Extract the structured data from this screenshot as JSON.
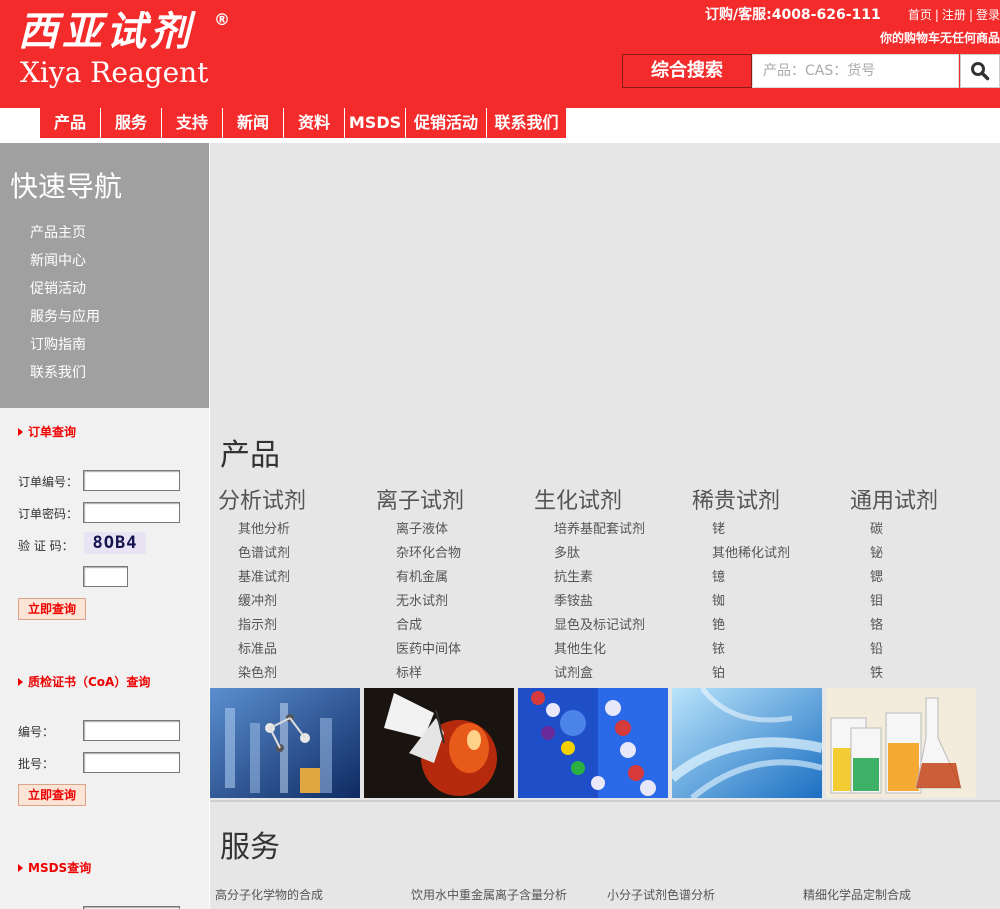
{
  "header": {
    "logo_cn": "西亚试剂",
    "logo_registered": "®",
    "logo_en": "Xiya Reagent",
    "hotline": "订购/客服:4008-626-111",
    "links": [
      "首页",
      "注册",
      "登录"
    ],
    "link_sep": "|",
    "cart_status": "你的购物车无任何商品",
    "search_label": "综合搜索",
    "search_placeholder": "产品：CAS：货号"
  },
  "nav": [
    "产品",
    "服务",
    "支持",
    "新闻",
    "资料",
    "MSDS",
    "促销活动",
    "联系我们"
  ],
  "quicknav": {
    "title": "快速导航",
    "items": [
      "产品主页",
      "新闻中心",
      "促销活动",
      "服务与应用",
      "订购指南",
      "联系我们"
    ]
  },
  "order_query": {
    "title": "订单查询",
    "order_no_label": "订单编号：",
    "order_pwd_label": "订单密码：",
    "captcha_label": "验 证 码：",
    "captcha_text": "8OB4",
    "submit": "立即查询"
  },
  "coa_query": {
    "title": "质检证书（CoA）查询",
    "no_label": "编号：",
    "batch_label": "批号：",
    "submit": "立即查询"
  },
  "msds_query": {
    "title": "MSDS查询"
  },
  "products": {
    "title": "产品",
    "categories": [
      {
        "title": "分析试剂",
        "items": [
          "其他分析",
          "色谱试剂",
          "基准试剂",
          "缓冲剂",
          "指示剂",
          "标准品",
          "染色剂"
        ]
      },
      {
        "title": "离子试剂",
        "items": [
          "离子液体",
          "杂环化合物",
          "有机金属",
          "无水试剂",
          "合成",
          "医药中间体",
          "标样"
        ]
      },
      {
        "title": "生化试剂",
        "items": [
          "培养基配套试剂",
          "多肽",
          "抗生素",
          "季铵盐",
          "显色及标记试剂",
          "其他生化",
          "试剂盒"
        ]
      },
      {
        "title": "稀贵试剂",
        "items": [
          "铑",
          "其他稀化试剂",
          "镱",
          "铷",
          "铯",
          "铱",
          "铂"
        ]
      },
      {
        "title": "通用试剂",
        "items": [
          "碳",
          "铋",
          "锶",
          "钼",
          "铬",
          "铅",
          "铁"
        ]
      }
    ],
    "thumbnails": [
      "glassware-molecule-image",
      "butterfly-image",
      "dna-helix-image",
      "blue-tubes-image",
      "beakers-image"
    ]
  },
  "services": {
    "title": "服务",
    "items": [
      "高分子化学物的合成",
      "饮用水中重金属离子含量分析",
      "小分子试剂色谱分析",
      "精细化学品定制合成"
    ]
  }
}
